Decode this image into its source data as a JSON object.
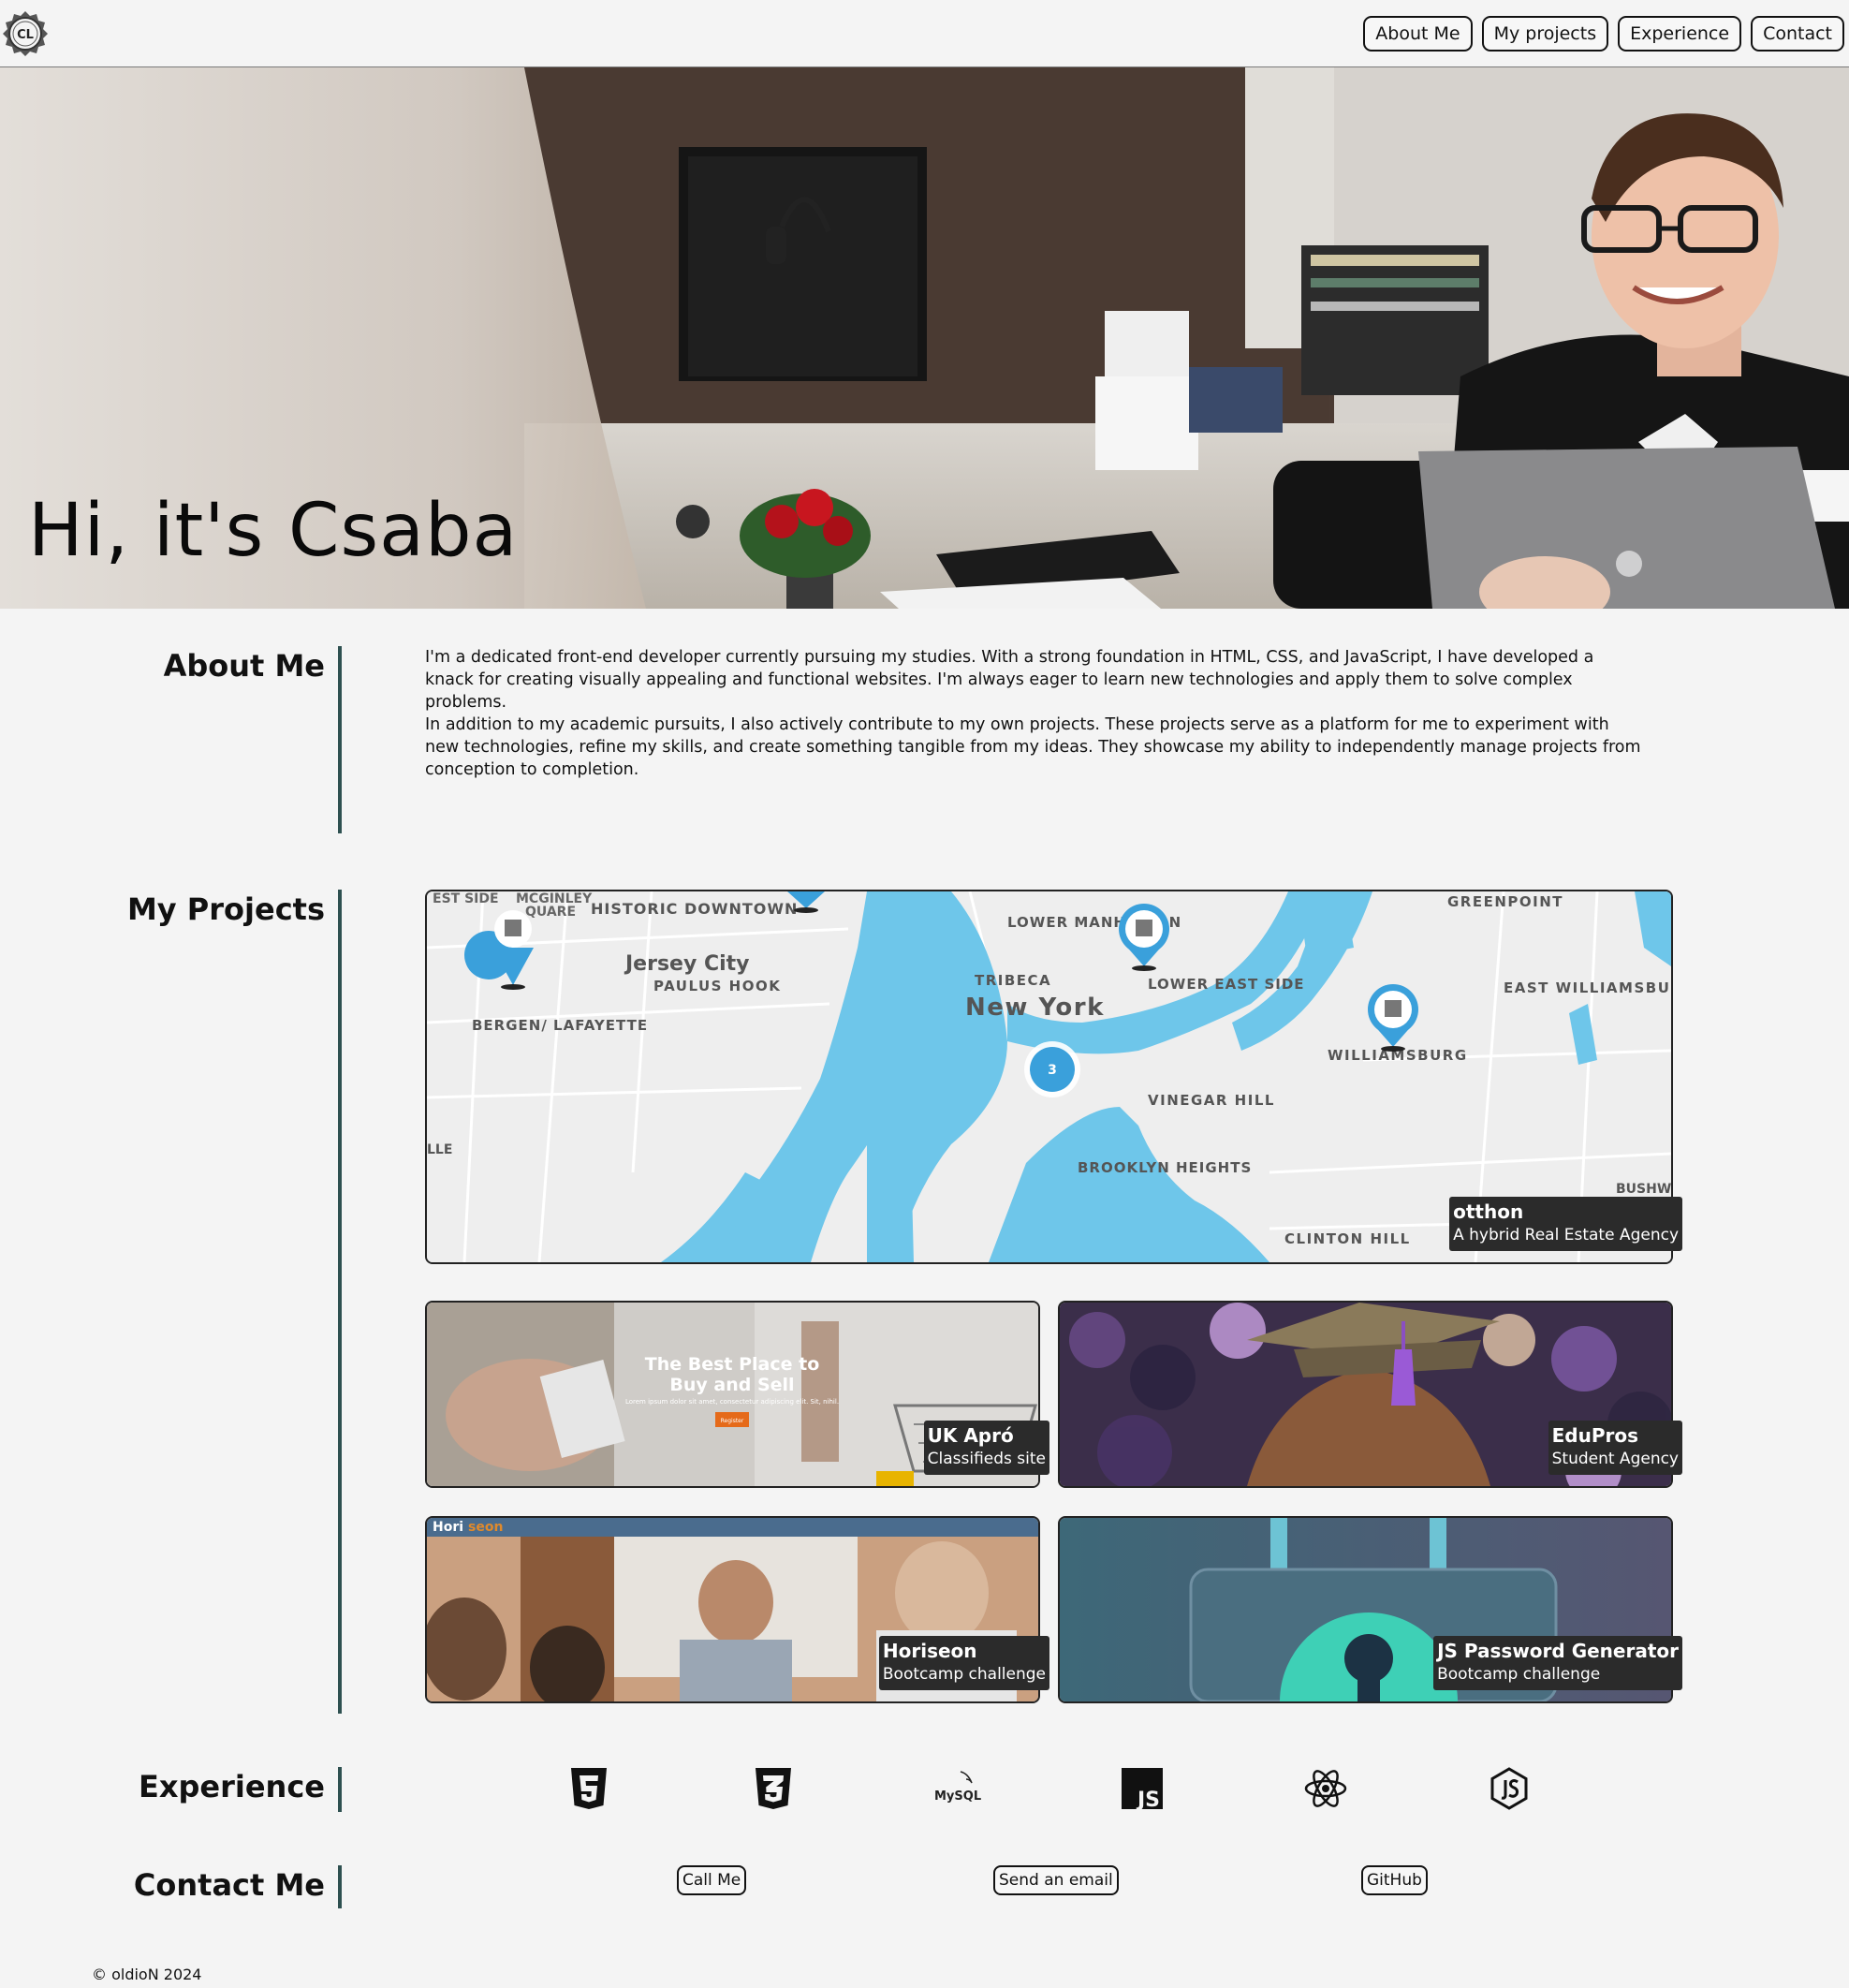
{
  "header": {
    "logo_text": "CL",
    "nav": [
      {
        "label": "About Me"
      },
      {
        "label": "My projects"
      },
      {
        "label": "Experience"
      },
      {
        "label": "Contact"
      }
    ]
  },
  "hero": {
    "title": "Hi, it's Csaba"
  },
  "about": {
    "heading": "About Me",
    "paragraphs": [
      "I'm a dedicated front-end developer currently pursuing my studies. With a strong foundation in HTML, CSS, and JavaScript, I have developed a knack for creating visually appealing and functional websites. I'm always eager to learn new technologies and apply them to solve complex problems.",
      "In addition to my academic pursuits, I also actively contribute to my own projects. These projects serve as a platform for me to experiment with new technologies, refine my skills, and create something tangible from my ideas. They showcase my ability to independently manage projects from conception to completion."
    ]
  },
  "projects": {
    "heading": "My Projects",
    "items": [
      {
        "title": "otthon",
        "subtitle": "A hybrid Real Estate Agency"
      },
      {
        "title": "UK Apró",
        "subtitle": "Classifieds site",
        "thumb_headline": "The Best Place to Buy and Sell",
        "thumb_button": "Register"
      },
      {
        "title": "EduPros",
        "subtitle": "Student Agency"
      },
      {
        "title": "Horiseon",
        "subtitle": "Bootcamp challenge"
      },
      {
        "title": "JS Password Generator",
        "subtitle": "Bootcamp challenge"
      }
    ],
    "map_labels": {
      "jersey_city": "Jersey City",
      "new_york": "New York",
      "tribeca": "TRIBECA",
      "williamsburg": "WILLIAMSBURG",
      "greenpoint": "GREENPOINT",
      "lower_manhattan": "LOWER MANHATTAN",
      "lower_east_side": "LOWER EAST SIDE",
      "east_williamsburg": "EAST WILLIAMSBURG",
      "vinegar_hill": "VINEGAR HILL",
      "brooklyn_heights": "BROOKLYN HEIGHTS",
      "clinton_hill": "CLINTON HILL",
      "bergen_lafayette": "BERGEN/ LAFAYETTE",
      "paulus_hook": "PAULUS HOOK",
      "historic_downtown": "HISTORIC DOWNTOWN",
      "cluster_count": "3"
    }
  },
  "experience": {
    "heading": "Experience",
    "icons": [
      "html5-icon",
      "css3-icon",
      "mysql-icon",
      "javascript-icon",
      "react-icon",
      "nodejs-icon"
    ],
    "mysql_text": "MySQL",
    "js_text": "JS"
  },
  "contact": {
    "heading": "Contact Me",
    "buttons": [
      {
        "label": "Call Me"
      },
      {
        "label": "Send an email"
      },
      {
        "label": "GitHub"
      }
    ]
  },
  "footer": {
    "text": "© oldioN 2024"
  },
  "colors": {
    "accent_bar": "#2e5050",
    "water": "#6ec6ea",
    "caption_bg": "#2b2b2b",
    "page_bg": "#f4f4f4"
  }
}
